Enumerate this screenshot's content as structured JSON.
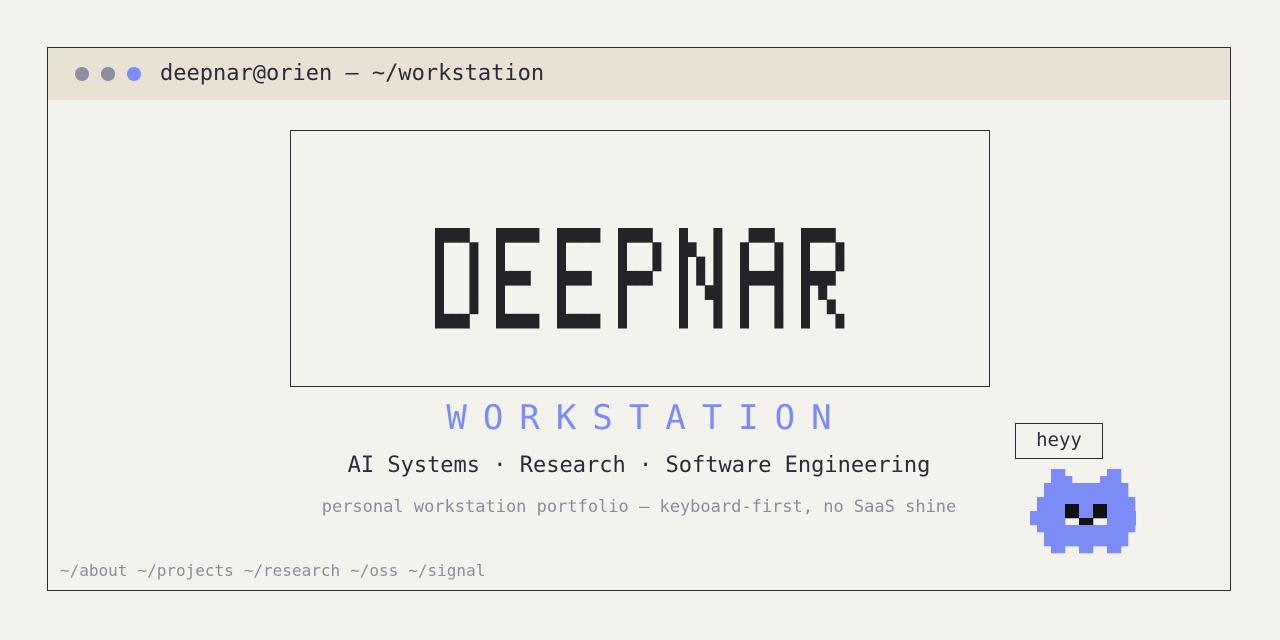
{
  "colors": {
    "accent": "#7b8cf7",
    "ink": "#2c2b3a",
    "muted": "#8a8d9e",
    "dot_gray": "#8e8ea0",
    "titlebar_bg": "#e8e1d4",
    "page_bg": "#f3f2ed",
    "logo_ink": "#242428"
  },
  "window": {
    "title": "deepnar@orien — ~/workstation",
    "controls": [
      "window-control-dot",
      "window-control-dot",
      "window-control-dot-active"
    ]
  },
  "hero": {
    "logo_text": "DEEPNAR",
    "subtitle": "WORKSTATION",
    "tagline": "AI Systems · Research · Software Engineering",
    "description": "personal workstation portfolio — keyboard-first, no SaaS shine"
  },
  "nav": {
    "links": [
      "~/about",
      "~/projects",
      "~/research",
      "~/oss",
      "~/signal"
    ]
  },
  "mascot": {
    "speech": "heyy",
    "icon": "pixel-cat-mascot-icon"
  }
}
